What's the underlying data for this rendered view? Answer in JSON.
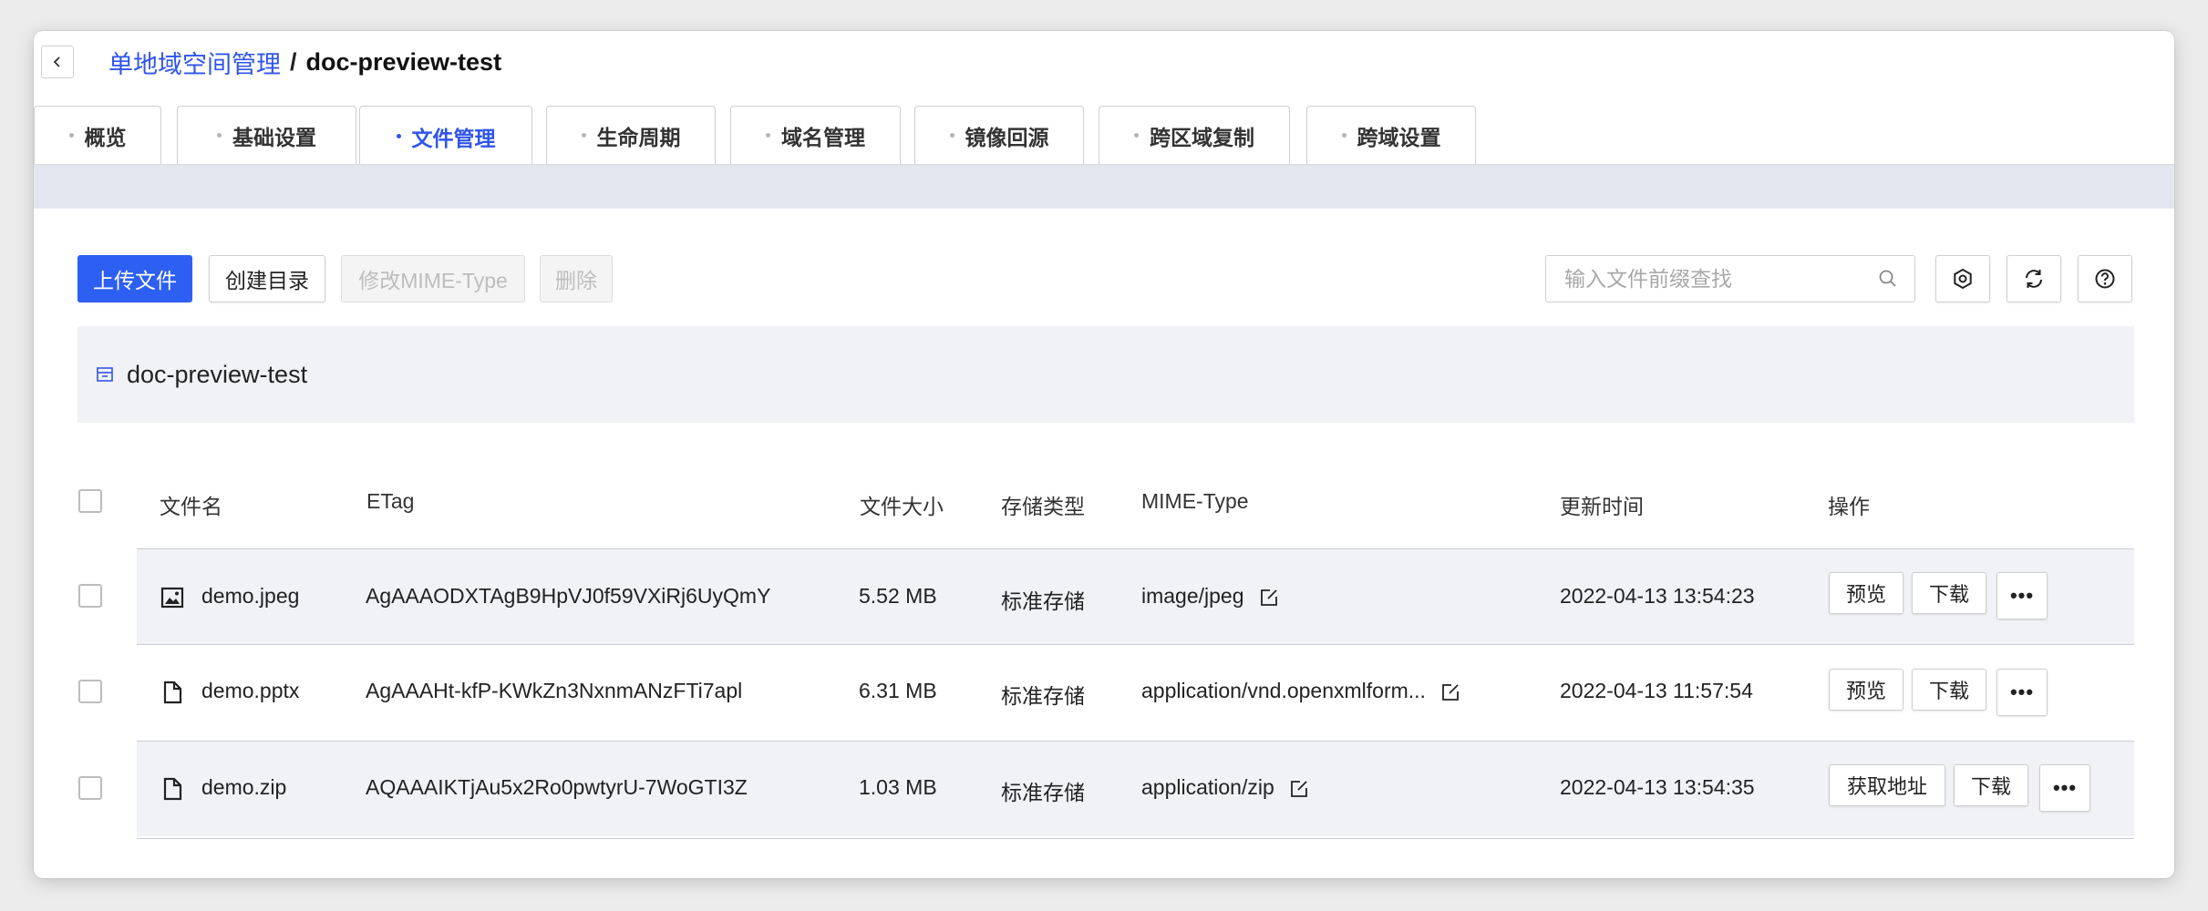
{
  "breadcrumb": {
    "parent": "单地域空间管理",
    "separator": "/",
    "current": "doc-preview-test"
  },
  "tabs": [
    {
      "label": "概览"
    },
    {
      "label": "基础设置"
    },
    {
      "label": "文件管理"
    },
    {
      "label": "生命周期"
    },
    {
      "label": "域名管理"
    },
    {
      "label": "镜像回源"
    },
    {
      "label": "跨区域复制"
    },
    {
      "label": "跨域设置"
    }
  ],
  "active_tab": "文件管理",
  "toolbar": {
    "upload": "上传文件",
    "mkdir": "创建目录",
    "modify_mime": "修改MIME-Type",
    "delete": "删除"
  },
  "search": {
    "placeholder": "输入文件前缀查找"
  },
  "path": "doc-preview-test",
  "table": {
    "headers": [
      "文件名",
      "ETag",
      "文件大小",
      "存储类型",
      "MIME-Type",
      "更新时间",
      "操作"
    ],
    "rows": [
      {
        "icon": "image-file-icon",
        "name": "demo.jpeg",
        "etag": "AgAAAODXTAgB9HpVJ0f59VXiRj6UyQmY",
        "size": "5.52 MB",
        "storage": "标准存储",
        "mime": "image/jpeg",
        "updated": "2022-04-13 13:54:23",
        "actions": [
          "预览",
          "下载"
        ]
      },
      {
        "icon": "document-file-icon",
        "name": "demo.pptx",
        "etag": "AgAAAHt-kfP-KWkZn3NxnmANzFTi7apl",
        "size": "6.31 MB",
        "storage": "标准存储",
        "mime": "application/vnd.openxmlform...",
        "updated": "2022-04-13 11:57:54",
        "actions": [
          "预览",
          "下载"
        ]
      },
      {
        "icon": "document-file-icon",
        "name": "demo.zip",
        "etag": "AQAAAIKTjAu5x2Ro0pwtyrU-7WoGTI3Z",
        "size": "1.03 MB",
        "storage": "标准存储",
        "mime": "application/zip",
        "updated": "2022-04-13 13:54:35",
        "actions": [
          "获取地址",
          "下载"
        ]
      }
    ],
    "more_label": "•••"
  },
  "colors": {
    "accent": "#2f54eb",
    "primary_button": "#2d5ff2",
    "band": "#e3e6ee",
    "row_shade": "#f1f2f6"
  }
}
